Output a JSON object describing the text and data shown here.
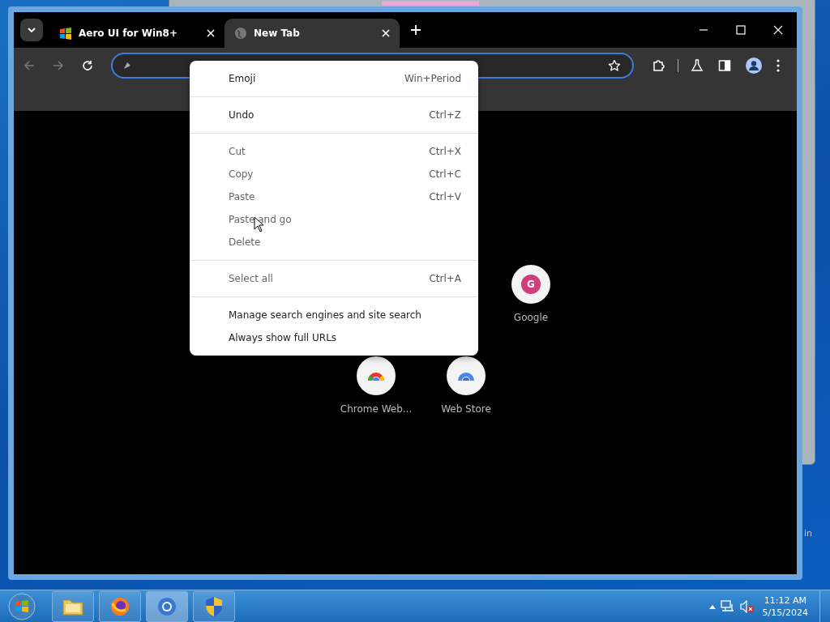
{
  "desktop": {
    "label_fragment": "in"
  },
  "browser": {
    "tabs": [
      {
        "title": "Aero UI for Win8+",
        "selected": false,
        "kind": "windows"
      },
      {
        "title": "New Tab",
        "selected": true,
        "kind": "globe"
      }
    ],
    "shortcuts": [
      {
        "label": "Google",
        "kind": "letter",
        "letter": "G"
      },
      {
        "label": "Chrome Web...",
        "kind": "chrome"
      },
      {
        "label": "Web Store",
        "kind": "store"
      }
    ]
  },
  "context_menu": [
    {
      "kind": "item",
      "label": "Emoji",
      "shortcut": "Win+Period",
      "disabled": false
    },
    {
      "kind": "separator"
    },
    {
      "kind": "item",
      "label": "Undo",
      "shortcut": "Ctrl+Z",
      "disabled": false
    },
    {
      "kind": "separator"
    },
    {
      "kind": "item",
      "label": "Cut",
      "shortcut": "Ctrl+X",
      "disabled": true
    },
    {
      "kind": "item",
      "label": "Copy",
      "shortcut": "Ctrl+C",
      "disabled": true
    },
    {
      "kind": "item",
      "label": "Paste",
      "shortcut": "Ctrl+V",
      "disabled": true
    },
    {
      "kind": "item",
      "label": "Paste and go",
      "disabled": true
    },
    {
      "kind": "item",
      "label": "Delete",
      "disabled": true
    },
    {
      "kind": "separator"
    },
    {
      "kind": "item",
      "label": "Select all",
      "shortcut": "Ctrl+A",
      "disabled": true
    },
    {
      "kind": "separator"
    },
    {
      "kind": "item",
      "label": "Manage search engines and site search",
      "disabled": false
    },
    {
      "kind": "item",
      "label": "Always show full URLs",
      "disabled": false
    }
  ],
  "taskbar": {
    "apps": [
      {
        "kind": "folder",
        "selected": false
      },
      {
        "kind": "firefox",
        "selected": false
      },
      {
        "kind": "chrome",
        "selected": true
      },
      {
        "kind": "shield",
        "selected": false
      }
    ],
    "time": "11:12 AM",
    "date": "5/15/2024"
  }
}
